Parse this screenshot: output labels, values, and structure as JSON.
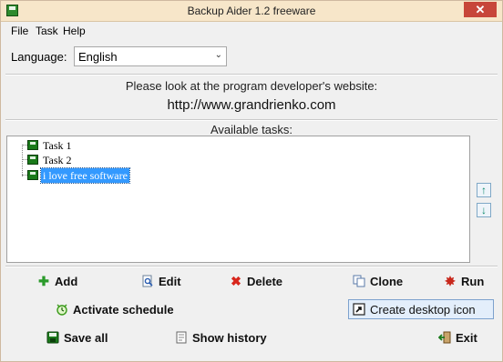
{
  "window": {
    "title": "Backup Aider 1.2 freeware",
    "close_glyph": "✕"
  },
  "menu": {
    "items": [
      "File",
      "Task",
      "Help"
    ]
  },
  "language": {
    "label": "Language:",
    "selected": "English",
    "arrow": "⌄"
  },
  "developer": {
    "text": "Please look at the program developer's website:",
    "url": "http://www.grandrienko.com"
  },
  "tasks": {
    "header": "Available tasks:",
    "items": [
      {
        "label": "Task 1",
        "selected": false
      },
      {
        "label": "Task 2",
        "selected": false
      },
      {
        "label": "i love free software",
        "selected": true
      }
    ],
    "move_up": "↑",
    "move_down": "↓"
  },
  "buttons": {
    "add": "Add",
    "edit": "Edit",
    "delete": "Delete",
    "clone": "Clone",
    "run": "Run",
    "activate_schedule": "Activate schedule",
    "create_desktop_icon": "Create desktop icon",
    "save_all": "Save all",
    "show_history": "Show history",
    "exit": "Exit"
  },
  "icons": {
    "add": "plus-icon",
    "edit": "magnifier-page-icon",
    "delete": "red-x-icon",
    "clone": "copy-pages-icon",
    "run": "gear-icon",
    "activate_schedule": "alarm-clock-icon",
    "create_desktop_icon": "shortcut-arrow-icon",
    "save_all": "disk-icon",
    "show_history": "document-icon",
    "exit": "exit-door-icon"
  },
  "colors": {
    "titlebar": "#f7e6c9",
    "close": "#c7463a",
    "selection": "#3399ff",
    "task_icon": "#1a7a1a",
    "add_green": "#2a9a2a",
    "delete_red": "#d8261c"
  }
}
